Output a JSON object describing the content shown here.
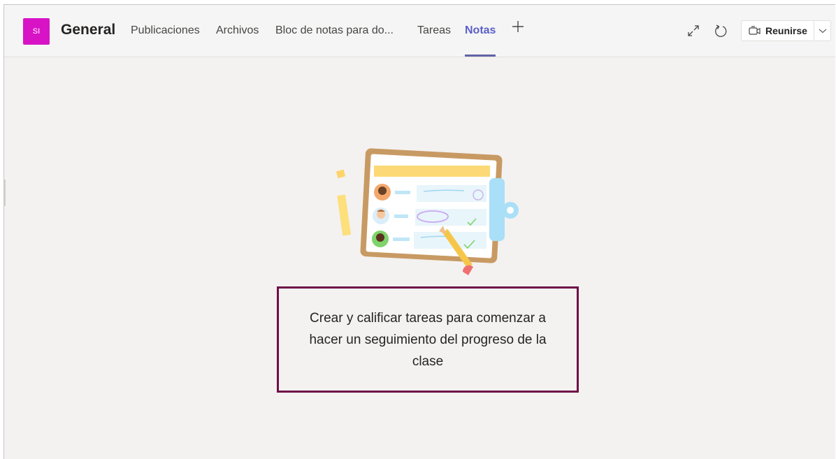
{
  "header": {
    "avatar_initials": "SI",
    "avatar_color": "#d813c6",
    "channel_title": "General",
    "tabs": [
      {
        "label": "Publicaciones",
        "active": false
      },
      {
        "label": "Archivos",
        "active": false
      },
      {
        "label": "Bloc de notas para do...",
        "active": false
      },
      {
        "label": "Tareas",
        "active": false
      },
      {
        "label": "Notas",
        "active": true
      }
    ],
    "add_tab_icon": "plus-icon",
    "tools": {
      "expand_icon": "expand-icon",
      "reload_icon": "reload-icon",
      "meet_label": "Reunirse",
      "meet_icon": "video-camera-icon",
      "meet_dropdown_icon": "chevron-down-icon"
    },
    "accent_color": "#6264a7"
  },
  "main": {
    "illustration": "clipboard-grades-illustration",
    "message": "Crear y calificar tareas para comenzar a hacer un seguimiento del progreso de la clase",
    "callout_border_color": "#6f0f47"
  }
}
